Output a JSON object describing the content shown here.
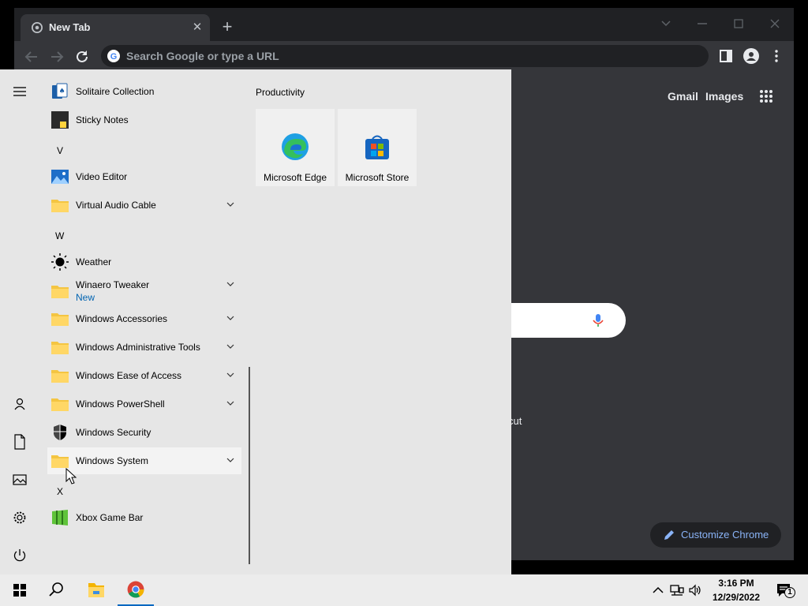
{
  "browser": {
    "tab_title": "New Tab",
    "omnibox_placeholder": "Search Google or type a URL",
    "header_links": {
      "gmail": "Gmail",
      "images": "Images"
    },
    "shortcut_fragment": "cut",
    "customize_label": "Customize Chrome",
    "accent": "#8ab4f8"
  },
  "start_menu": {
    "section_letters": {
      "v": "V",
      "w": "W",
      "x": "X"
    },
    "apps": {
      "solitaire": "Solitaire Collection",
      "sticky": "Sticky Notes",
      "video": "Video Editor",
      "vac": "Virtual Audio Cable",
      "weather": "Weather",
      "winaero": "Winaero Tweaker",
      "winaero_badge": "New",
      "accessories": "Windows Accessories",
      "admin": "Windows Administrative Tools",
      "ease": "Windows Ease of Access",
      "powershell": "Windows PowerShell",
      "security": "Windows Security",
      "system": "Windows System",
      "xbox": "Xbox Game Bar"
    },
    "tiles_group": "Productivity",
    "tiles": {
      "edge": "Microsoft Edge",
      "store": "Microsoft Store"
    }
  },
  "taskbar": {
    "time": "3:16 PM",
    "date": "12/29/2022",
    "notification_count": "1"
  }
}
